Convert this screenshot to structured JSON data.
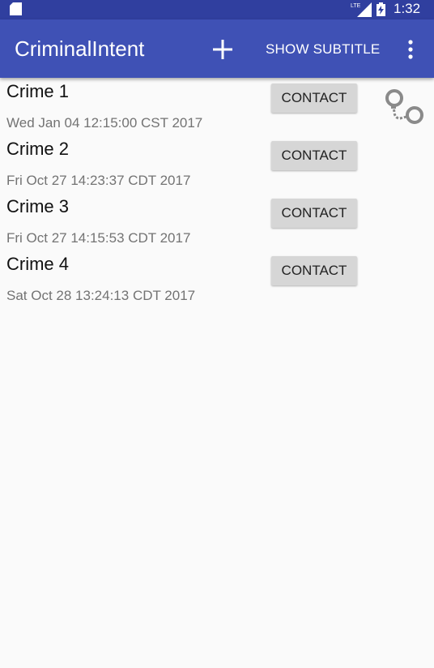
{
  "status_bar": {
    "network_label": "LTE",
    "time": "1:32"
  },
  "app_bar": {
    "title": "CriminalIntent",
    "show_subtitle_label": "SHOW SUBTITLE",
    "add_icon": "plus-icon",
    "overflow_icon": "more-vert-icon"
  },
  "crimes": [
    {
      "title": "Crime 1",
      "date": "Wed Jan 04 12:15:00 CST 2017",
      "contact_label": "CONTACT",
      "solved": true
    },
    {
      "title": "Crime 2",
      "date": "Fri Oct 27 14:23:37 CDT 2017",
      "contact_label": "CONTACT",
      "solved": false
    },
    {
      "title": "Crime 3",
      "date": "Fri Oct 27 14:15:53 CDT 2017",
      "contact_label": "CONTACT",
      "solved": false
    },
    {
      "title": "Crime 4",
      "date": "Sat Oct 28 13:24:13 CDT 2017",
      "contact_label": "CONTACT",
      "solved": false
    }
  ],
  "colors": {
    "status_bar": "#303F9F",
    "app_bar": "#3F51B5",
    "background": "#fafafa",
    "contact_button": "#d6d6d6"
  }
}
